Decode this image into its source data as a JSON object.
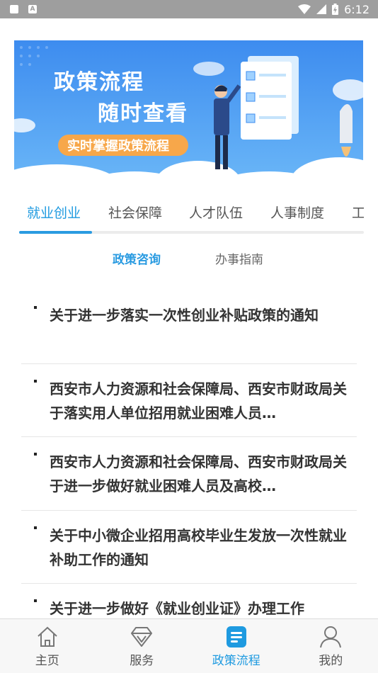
{
  "statusbar": {
    "time": "6:12",
    "battery_icon": "battery-charging-icon",
    "wifi_icon": "wifi-icon",
    "signal_icon": "signal-icon"
  },
  "banner": {
    "title_line1": "政策流程",
    "title_line2": "随时查看",
    "tag": "实时掌握政策流程",
    "colors": {
      "bg_top": "#3f8ff0",
      "bg_bottom": "#5fb3f7",
      "tag": "#f7a74a"
    }
  },
  "tabs": {
    "items": [
      "就业创业",
      "社会保障",
      "人才队伍",
      "人事制度",
      "工"
    ],
    "active_index": 0
  },
  "subtabs": {
    "items": [
      "政策咨询",
      "办事指南"
    ],
    "active_index": 0
  },
  "list": {
    "items": [
      "关于进一步落实一次性创业补贴政策的通知",
      "西安市人力资源和社会保障局、西安市财政局关于落实用人单位招用就业困难人员…",
      "西安市人力资源和社会保障局、西安市财政局关于进一步做好就业困难人员及高校…",
      "关于中小微企业招用高校毕业生发放一次性就业补助工作的通知",
      "关于进一步做好《就业创业证》办理工作"
    ]
  },
  "bottomnav": {
    "items": [
      {
        "label": "主页",
        "icon": "home-icon"
      },
      {
        "label": "服务",
        "icon": "diamond-icon"
      },
      {
        "label": "政策流程",
        "icon": "document-icon"
      },
      {
        "label": "我的",
        "icon": "user-icon"
      }
    ],
    "active_index": 2,
    "accent": "#1e9ae0"
  }
}
